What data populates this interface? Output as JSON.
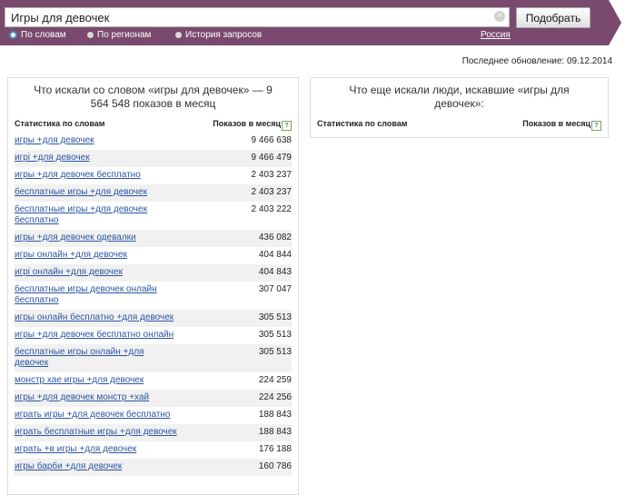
{
  "header": {
    "search_value": "Игры для девочек",
    "clear_glyph": "×",
    "submit_label": "Подобрать",
    "modes": [
      {
        "label": "По словам",
        "selected": true
      },
      {
        "label": "По регионам",
        "selected": false
      },
      {
        "label": "История запросов",
        "selected": false
      }
    ],
    "region": "Россия",
    "brand_color": "#7a4a6e"
  },
  "last_update": "Последнее обновление: 09.12.2014",
  "left_panel": {
    "title": "Что искали со словом «игры для девочек» — 9 564 548 показов в месяц",
    "col_phrase": "Статистика по словам",
    "col_count": "Показов в месяц",
    "help_glyph": "?",
    "rows": [
      {
        "phrase": "игры +для девочек",
        "count": "9 466 638"
      },
      {
        "phrase": "игрi +для девочек",
        "count": "9 466 479"
      },
      {
        "phrase": "игры +для девочек бесплатно",
        "count": "2 403 237"
      },
      {
        "phrase": "бесплатные игры +для девочек",
        "count": "2 403 237"
      },
      {
        "phrase": "бесплатные игры +для девочек бесплатно",
        "count": "2 403 222"
      },
      {
        "phrase": "игры +для девочек одевалки",
        "count": "436 082"
      },
      {
        "phrase": "игры онлайн +для девочек",
        "count": "404 844"
      },
      {
        "phrase": "игрi онлайн +для девочек",
        "count": "404 843"
      },
      {
        "phrase": "бесплатные игры девочек онлайн бесплатно",
        "count": "307 047"
      },
      {
        "phrase": "игры онлайн бесплатно +для девочек",
        "count": "305 513"
      },
      {
        "phrase": "игры +для девочек бесплатно онлайн",
        "count": "305 513"
      },
      {
        "phrase": "бесплатные игры онлайн +для девочек",
        "count": "305 513"
      },
      {
        "phrase": "монстр хае игры +для девочек",
        "count": "224 259"
      },
      {
        "phrase": "игры +для девочек монстр +хай",
        "count": "224 256"
      },
      {
        "phrase": "играть игры +для девочек бесплатно",
        "count": "188 843"
      },
      {
        "phrase": "играть бесплатные игры +для девочек",
        "count": "188 843"
      },
      {
        "phrase": "играть +в игры +для девочек",
        "count": "176 188"
      },
      {
        "phrase": "игры барби +для девочек",
        "count": "160 786"
      }
    ]
  },
  "right_panel": {
    "title": "Что еще искали люди, искавшие «игры для девочек»:",
    "col_phrase": "Статистика по словам",
    "col_count": "Показов в месяц",
    "help_glyph": "?"
  }
}
